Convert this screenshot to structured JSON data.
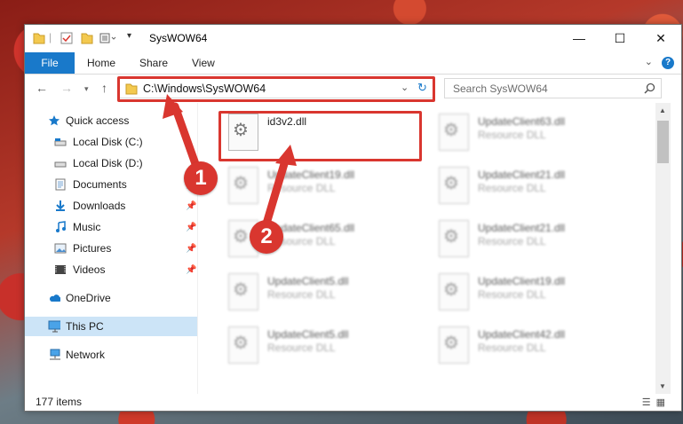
{
  "window": {
    "title": "SysWOW64"
  },
  "ribbon": {
    "tabs": [
      "File",
      "Home",
      "Share",
      "View"
    ]
  },
  "address": {
    "path": "C:\\Windows\\SysWOW64"
  },
  "search": {
    "placeholder": "Search SysWOW64"
  },
  "sidebar": {
    "items": [
      {
        "label": "Quick access",
        "icon": "star-icon",
        "pinned": false
      },
      {
        "label": "Local Disk (C:)",
        "icon": "drive-icon",
        "pinned": false
      },
      {
        "label": "Local Disk (D:)",
        "icon": "drive-icon",
        "pinned": false
      },
      {
        "label": "Documents",
        "icon": "documents-icon",
        "pinned": true
      },
      {
        "label": "Downloads",
        "icon": "downloads-icon",
        "pinned": true
      },
      {
        "label": "Music",
        "icon": "music-icon",
        "pinned": true
      },
      {
        "label": "Pictures",
        "icon": "pictures-icon",
        "pinned": true
      },
      {
        "label": "Videos",
        "icon": "videos-icon",
        "pinned": true
      },
      {
        "label": "OneDrive",
        "icon": "cloud-icon",
        "pinned": false
      },
      {
        "label": "This PC",
        "icon": "computer-icon",
        "pinned": false,
        "selected": true
      },
      {
        "label": "Network",
        "icon": "network-icon",
        "pinned": false
      }
    ]
  },
  "files": [
    {
      "name": "id3v2.dll",
      "type": ""
    },
    {
      "name": "UpdateClient63.dll",
      "type": "Resource DLL"
    },
    {
      "name": "UpdateClient19.dll",
      "type": "Resource DLL"
    },
    {
      "name": "UpdateClient21.dll",
      "type": "Resource DLL"
    },
    {
      "name": "UpdateClient65.dll",
      "type": "Resource DLL"
    },
    {
      "name": "UpdateClient21.dll",
      "type": "Resource DLL"
    },
    {
      "name": "UpdateClient5.dll",
      "type": "Resource DLL"
    },
    {
      "name": "UpdateClient19.dll",
      "type": "Resource DLL"
    },
    {
      "name": "UpdateClient5.dll",
      "type": "Resource DLL"
    },
    {
      "name": "UpdateClient42.dll",
      "type": "Resource DLL"
    }
  ],
  "status": {
    "count": "177 items"
  },
  "callouts": [
    "1",
    "2"
  ],
  "colors": {
    "accent": "#1979ca",
    "highlight": "#d9362f",
    "selected": "#cce4f7"
  }
}
